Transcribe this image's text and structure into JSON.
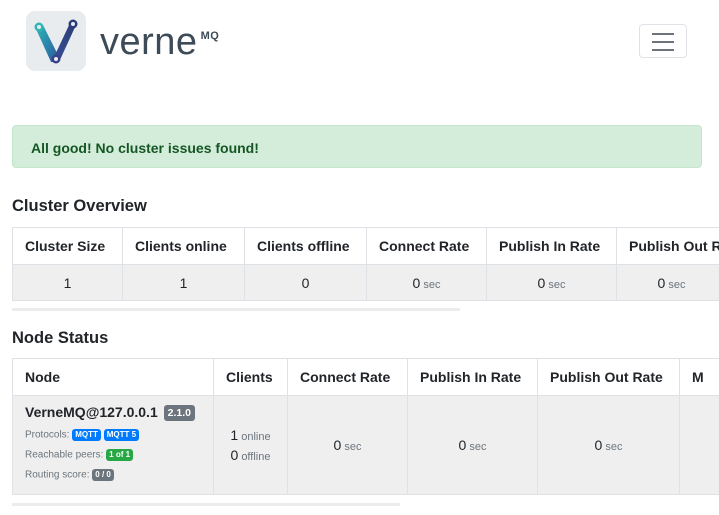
{
  "brand": {
    "name": "verne",
    "suffix": "MQ"
  },
  "alert": {
    "text": "All good! No cluster issues found!"
  },
  "cluster_overview": {
    "title": "Cluster Overview",
    "headers": [
      "Cluster Size",
      "Clients online",
      "Clients offline",
      "Connect Rate",
      "Publish In Rate",
      "Publish Out Rate"
    ],
    "values": {
      "cluster_size": "1",
      "clients_online": "1",
      "clients_offline": "0",
      "connect_rate": "0",
      "publish_in_rate": "0",
      "publish_out_rate": "0"
    },
    "rate_unit": "sec"
  },
  "node_status": {
    "title": "Node Status",
    "headers": [
      "Node",
      "Clients",
      "Connect Rate",
      "Publish In Rate",
      "Publish Out Rate",
      "M"
    ],
    "node": {
      "name": "VerneMQ@127.0.0.1",
      "version": "2.1.0",
      "protocols_label": "Protocols:",
      "protocols": [
        "MQTT",
        "MQTT 5"
      ],
      "peers_label": "Reachable peers:",
      "peers": "1 of 1",
      "routing_label": "Routing score:",
      "routing": "0 / 0"
    },
    "clients_online": "1",
    "online_label": "online",
    "clients_offline": "0",
    "offline_label": "offline",
    "connect_rate": "0",
    "publish_in_rate": "0",
    "publish_out_rate": "0",
    "rate_unit": "sec"
  },
  "colors": {
    "alert_bg": "#d4edda",
    "alert_text": "#155724",
    "badge_blue": "#007bff",
    "badge_green": "#28a745",
    "badge_gray": "#6c757d",
    "logo_teal": "#27a8b3",
    "logo_navy": "#2a3d78"
  },
  "icons": {
    "logo": "vernemq-v-logo-icon",
    "menu": "hamburger-menu-icon"
  }
}
